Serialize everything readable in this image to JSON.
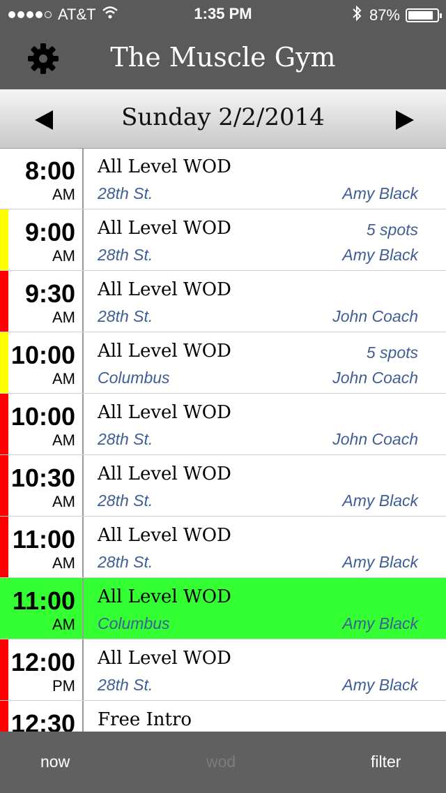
{
  "status_bar": {
    "carrier": "AT&T",
    "time": "1:35 PM",
    "battery": "87%",
    "battery_level": 0.87,
    "signal_dots_filled": 4
  },
  "navbar": {
    "title": "The Muscle Gym",
    "settings_icon": "gear-icon"
  },
  "date_bar": {
    "date": "Sunday 2/2/2014",
    "prev_icon": "triangle-left-icon",
    "next_icon": "triangle-right-icon"
  },
  "colors": {
    "red": "#ff0000",
    "yellow": "#ffff00",
    "green_highlight": "#33ff33",
    "meta_text": "#3e5e94"
  },
  "schedule": [
    {
      "time": "8:00",
      "ampm": "AM",
      "name": "All Level WOD",
      "location": "28th St.",
      "coach": "Amy Black",
      "spots": "",
      "stripe": "none",
      "highlight": false
    },
    {
      "time": "9:00",
      "ampm": "AM",
      "name": "All Level WOD",
      "location": "28th St.",
      "coach": "Amy Black",
      "spots": "5 spots",
      "stripe": "yellow",
      "highlight": false
    },
    {
      "time": "9:30",
      "ampm": "AM",
      "name": "All Level WOD",
      "location": "28th St.",
      "coach": "John Coach",
      "spots": "",
      "stripe": "red",
      "highlight": false
    },
    {
      "time": "10:00",
      "ampm": "AM",
      "name": "All Level WOD",
      "location": "Columbus",
      "coach": "John Coach",
      "spots": "5 spots",
      "stripe": "yellow",
      "highlight": false
    },
    {
      "time": "10:00",
      "ampm": "AM",
      "name": "All Level WOD",
      "location": "28th St.",
      "coach": "John Coach",
      "spots": "",
      "stripe": "red",
      "highlight": false
    },
    {
      "time": "10:30",
      "ampm": "AM",
      "name": "All Level WOD",
      "location": "28th St.",
      "coach": "Amy Black",
      "spots": "",
      "stripe": "red",
      "highlight": false
    },
    {
      "time": "11:00",
      "ampm": "AM",
      "name": "All Level WOD",
      "location": "28th St.",
      "coach": "Amy Black",
      "spots": "",
      "stripe": "red",
      "highlight": false
    },
    {
      "time": "11:00",
      "ampm": "AM",
      "name": "All Level WOD",
      "location": "Columbus",
      "coach": "Amy Black",
      "spots": "",
      "stripe": "green",
      "highlight": true
    },
    {
      "time": "12:00",
      "ampm": "PM",
      "name": "All Level WOD",
      "location": "28th St.",
      "coach": "Amy Black",
      "spots": "",
      "stripe": "red",
      "highlight": false
    },
    {
      "time": "12:30",
      "ampm": "",
      "name": "Free Intro",
      "location": "",
      "coach": "",
      "spots": "",
      "stripe": "red",
      "highlight": false
    }
  ],
  "tab_bar": {
    "now": "now",
    "wod": "wod",
    "filter": "filter"
  }
}
